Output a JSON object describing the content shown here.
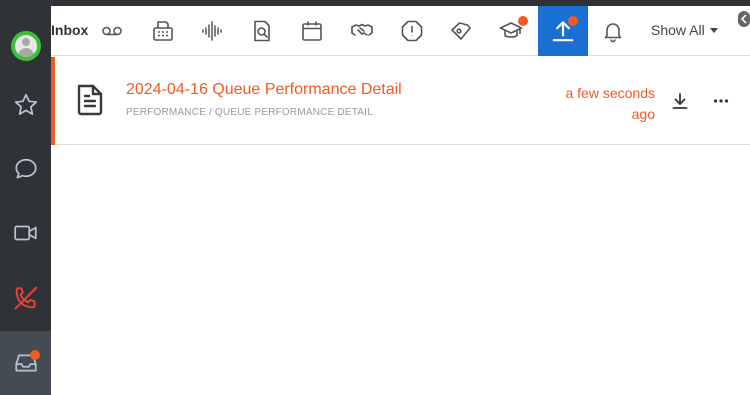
{
  "toolbar": {
    "inbox_label": "Inbox",
    "filter_label": "Show All",
    "icons": [
      "voicemail-icon",
      "fax-icon",
      "recording-icon",
      "document-search-icon",
      "calendar-icon",
      "handshake-icon",
      "alert-icon",
      "tag-icon",
      "education-icon",
      "upload-icon",
      "bell-icon"
    ],
    "active_icon": "upload-icon"
  },
  "sidebar": {
    "items": [
      "avatar",
      "star-icon",
      "chat-icon",
      "video-icon",
      "phone-missed-icon",
      "inbox-icon"
    ],
    "active_item": "inbox-icon"
  },
  "list": {
    "items": [
      {
        "title": "2024-04-16 Queue Performance Detail",
        "path": "PERFORMANCE / QUEUE PERFORMANCE DETAIL",
        "time": "a few seconds ago"
      }
    ]
  },
  "colors": {
    "accent": "#f15a22",
    "active_blue": "#1a6fd3",
    "sidebar_bg": "#2f3338",
    "presence_green": "#3cbf3c"
  }
}
